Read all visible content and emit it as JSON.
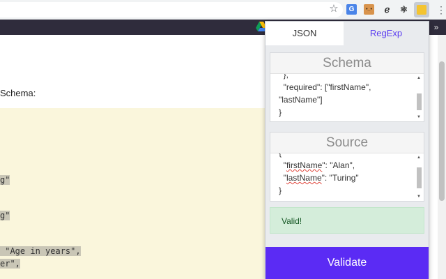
{
  "browser": {
    "star_icon": "☆",
    "ext_translate": "G",
    "ext_face": "•_•",
    "ext_feather": "ℯ",
    "ext_react": "⚛",
    "menu_icon": "⋮",
    "bookmarks_more": "»"
  },
  "page": {
    "schema_label": "Schema:",
    "code_lines": [
      {
        "text": "g\"",
        "highlight": true
      },
      {
        "text": "g\"",
        "highlight": true
      },
      {
        "text": " \"Age in years\",",
        "highlight": true
      },
      {
        "text": "er\",",
        "highlight": true
      }
    ]
  },
  "popup": {
    "tabs": [
      {
        "label": "JSON",
        "active": true
      },
      {
        "label": "RegExp",
        "active": false
      }
    ],
    "schema": {
      "title": "Schema",
      "lines": [
        "  },",
        "  \"required\": [\"firstName\",",
        "\"lastName\"]",
        "}"
      ]
    },
    "source": {
      "title": "Source",
      "lines": [
        "{",
        "  \"firstName\": \"Alan\",",
        "  \"lastName\": \"Turing\"",
        "}"
      ]
    },
    "status": "Valid!",
    "validate_label": "Validate"
  },
  "colors": {
    "accent": "#5b2bf4",
    "tab_regexp": "#5b3df0",
    "valid_bg": "#d4edda",
    "valid_text": "#155724",
    "code_bg": "#faf6dc",
    "bookmarks_bar": "#2f2c3c"
  }
}
